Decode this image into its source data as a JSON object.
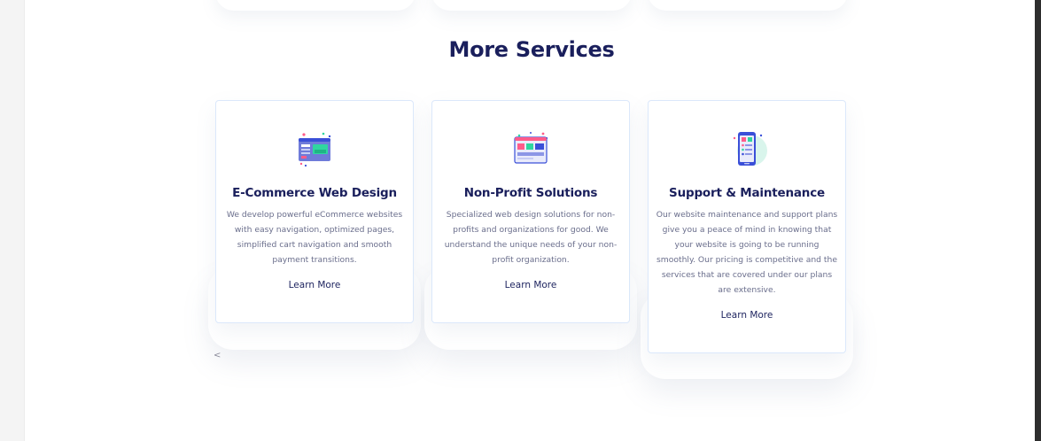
{
  "section": {
    "title": "More Services"
  },
  "cards": [
    {
      "icon": "ecommerce-browser-icon",
      "title": "E-Commerce Web Design",
      "description": "We develop powerful eCommerce websites with easy navigation, optimized pages, simplified cart navigation and smooth payment transitions.",
      "link_label": "Learn More"
    },
    {
      "icon": "nonprofit-window-icon",
      "title": "Non-Profit Solutions",
      "description": "Specialized web design solutions for non-profits and organizations for good. We understand the unique needs of your non-profit organization.",
      "link_label": "Learn More"
    },
    {
      "icon": "mobile-maintenance-icon",
      "title": "Support & Maintenance",
      "description": "Our website maintenance and support plans give you a peace of mind in knowing that your website is going to be running smoothly. Our pricing is competitive and the services that are covered under our plans are extensive.",
      "link_label": "Learn More"
    }
  ],
  "carousel": {
    "prev_label": "<"
  },
  "colors": {
    "heading": "#1a1f5c",
    "body_text": "#6a6e8c",
    "card_border": "#dbe8fb",
    "accent_blue": "#3a4fd8",
    "accent_pink": "#ff5c8a",
    "accent_green": "#2fd6a0"
  }
}
